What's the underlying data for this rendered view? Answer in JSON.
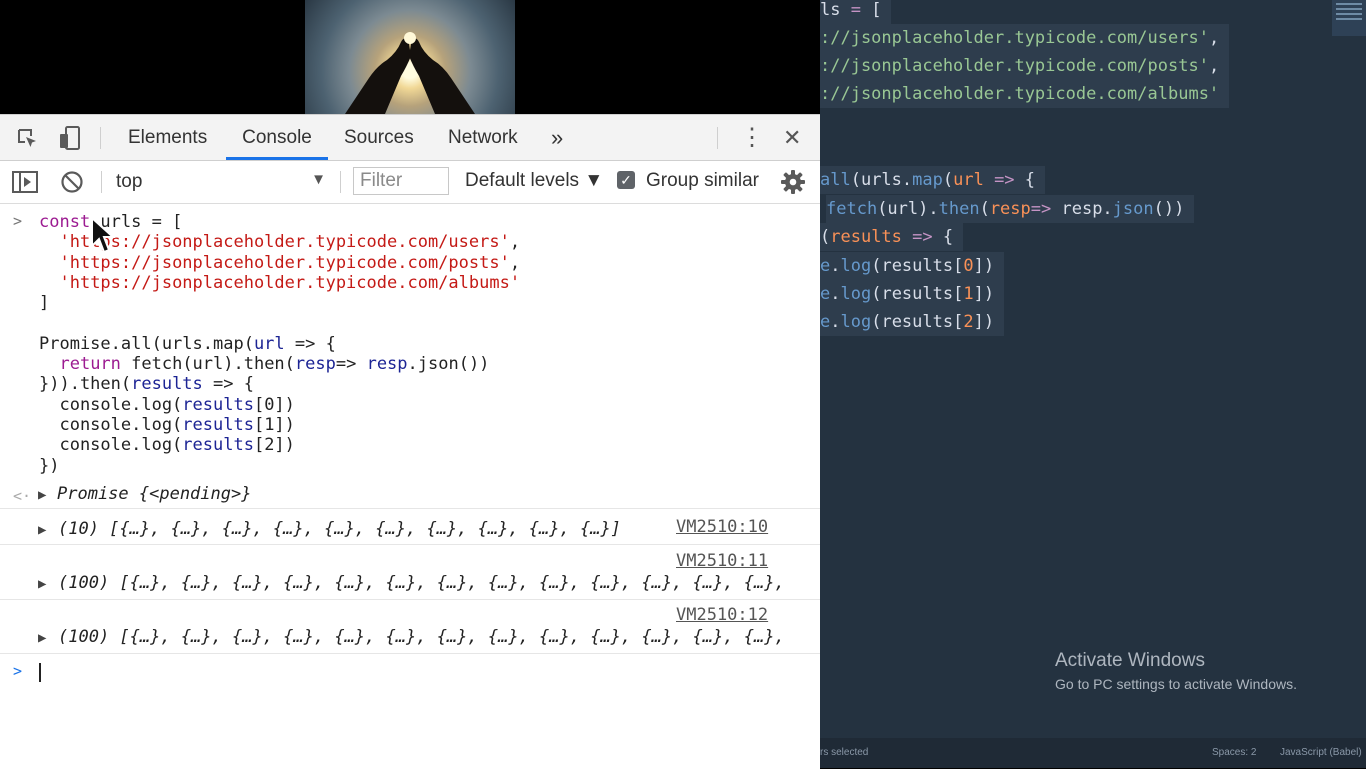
{
  "editor": {
    "lines": [
      [
        [
          "pl",
          "ls "
        ],
        [
          "op",
          "="
        ],
        [
          "pl",
          " ["
        ]
      ],
      [
        [
          "str",
          "://jsonplaceholder.typicode.com/users'"
        ],
        [
          "pl",
          ","
        ]
      ],
      [
        [
          "str",
          "://jsonplaceholder.typicode.com/posts'"
        ],
        [
          "pl",
          ","
        ]
      ],
      [
        [
          "str",
          "://jsonplaceholder.typicode.com/albums'"
        ]
      ],
      [
        [
          "fn",
          "all"
        ],
        [
          "pl",
          "(urls."
        ],
        [
          "fn",
          "map"
        ],
        [
          "pl",
          "("
        ],
        [
          "var",
          "url"
        ],
        [
          "op",
          " =>"
        ],
        [
          "pl",
          " {"
        ]
      ],
      [
        [
          "fn",
          "fetch"
        ],
        [
          "pl",
          "(url)."
        ],
        [
          "fn",
          "then"
        ],
        [
          "pl",
          "("
        ],
        [
          "var",
          "resp"
        ],
        [
          "op",
          "=>"
        ],
        [
          "pl",
          " resp."
        ],
        [
          "fn",
          "json"
        ],
        [
          "pl",
          "())"
        ]
      ],
      [
        [
          "pl",
          "("
        ],
        [
          "var",
          "results"
        ],
        [
          "op",
          " =>"
        ],
        [
          "pl",
          " {"
        ]
      ],
      [
        [
          "fn",
          "e"
        ],
        [
          "pl",
          "."
        ],
        [
          "fn",
          "log"
        ],
        [
          "pl",
          "(results["
        ],
        [
          "var",
          "0"
        ],
        [
          "pl",
          "])"
        ]
      ],
      [
        [
          "fn",
          "e"
        ],
        [
          "pl",
          "."
        ],
        [
          "fn",
          "log"
        ],
        [
          "pl",
          "(results["
        ],
        [
          "var",
          "1"
        ],
        [
          "pl",
          "])"
        ]
      ],
      [
        [
          "fn",
          "e"
        ],
        [
          "pl",
          "."
        ],
        [
          "fn",
          "log"
        ],
        [
          "pl",
          "(results["
        ],
        [
          "var",
          "2"
        ],
        [
          "pl",
          "])"
        ]
      ]
    ],
    "status_left": "rs selected",
    "status_spaces": "Spaces: 2",
    "status_syntax": "JavaScript (Babel)"
  },
  "watermark": {
    "title": "Activate Windows",
    "subtitle": "Go to PC settings to activate Windows."
  },
  "devtools": {
    "tabs": [
      "Elements",
      "Console",
      "Sources",
      "Network"
    ],
    "active_tab": "Console",
    "more_tabs": "»",
    "menu_icon": "⋮",
    "close_icon": "✕",
    "context": "top",
    "filter_placeholder": "Filter",
    "levels": "Default levels ▼",
    "group_similar": "Group similar",
    "group_similar_checked": true
  },
  "console": {
    "input_code": [
      [
        [
          "k",
          "const "
        ],
        [
          "p",
          "urls = ["
        ]
      ],
      [
        [
          "p",
          "  "
        ],
        [
          "s",
          "'https://jsonplaceholder.typicode.com/users'"
        ],
        [
          "p",
          ","
        ]
      ],
      [
        [
          "p",
          "  "
        ],
        [
          "s",
          "'https://jsonplaceholder.typicode.com/posts'"
        ],
        [
          "p",
          ","
        ]
      ],
      [
        [
          "p",
          "  "
        ],
        [
          "s",
          "'https://jsonplaceholder.typicode.com/albums'"
        ]
      ],
      [
        [
          "p",
          "]"
        ]
      ],
      [
        [
          "p",
          ""
        ]
      ],
      [
        [
          "p",
          "Promise.all(urls.map("
        ],
        [
          "v",
          "url"
        ],
        [
          "p",
          " => {"
        ]
      ],
      [
        [
          "p",
          "  "
        ],
        [
          "k",
          "return "
        ],
        [
          "p",
          "fetch(url).then("
        ],
        [
          "v",
          "resp"
        ],
        [
          "p",
          "=> "
        ],
        [
          "v",
          "resp"
        ],
        [
          "p",
          ".json())"
        ]
      ],
      [
        [
          "p",
          "})).then("
        ],
        [
          "v",
          "results"
        ],
        [
          "p",
          " => {"
        ]
      ],
      [
        [
          "p",
          "  console.log("
        ],
        [
          "v",
          "results"
        ],
        [
          "p",
          "[0])"
        ]
      ],
      [
        [
          "p",
          "  console.log("
        ],
        [
          "v",
          "results"
        ],
        [
          "p",
          "[1])"
        ]
      ],
      [
        [
          "p",
          "  console.log("
        ],
        [
          "v",
          "results"
        ],
        [
          "p",
          "[2])"
        ]
      ],
      [
        [
          "p",
          "})"
        ]
      ]
    ],
    "return_value": "Promise {<pending>}",
    "logs": [
      {
        "text": "(10) [{…}, {…}, {…}, {…}, {…}, {…}, {…}, {…}, {…}, {…}]",
        "source": "VM2510:10"
      },
      {
        "text": "(100) [{…}, {…}, {…}, {…}, {…}, {…}, {…}, {…}, {…}, {…}, {…}, {…}, {…},",
        "source": "VM2510:11"
      },
      {
        "text": "(100) [{…}, {…}, {…}, {…}, {…}, {…}, {…}, {…}, {…}, {…}, {…}, {…}, {…},",
        "source": "VM2510:12"
      }
    ]
  },
  "colors": {
    "editor_bg": "#243240",
    "accent": "#1a73e8"
  }
}
